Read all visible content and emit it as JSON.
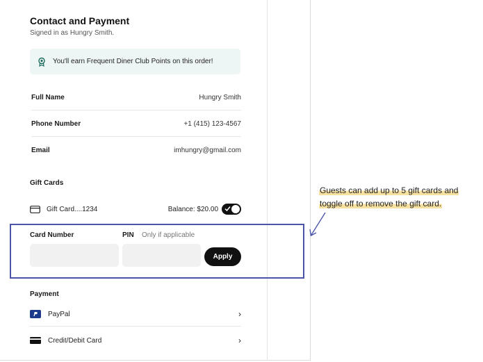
{
  "header": {
    "title": "Contact and Payment",
    "subtitle": "Signed in as Hungry Smith."
  },
  "banner": {
    "icon": "award-badge-icon",
    "text": "You'll earn Frequent Diner Club Points on this order!"
  },
  "contact": [
    {
      "label": "Full Name",
      "value": "Hungry Smith"
    },
    {
      "label": "Phone Number",
      "value": "+1 (415) 123-4567"
    },
    {
      "label": "Email",
      "value": "imhungry@gmail.com"
    }
  ],
  "gift_cards": {
    "section_title": "Gift Cards",
    "card_name": "Gift Card....1234",
    "balance": "Balance: $20.00",
    "toggle_on": true,
    "card_number_label": "Card Number",
    "pin_label": "PIN",
    "pin_hint": "Only if applicable",
    "card_number_value": "",
    "pin_value": "",
    "apply_label": "Apply"
  },
  "payment": {
    "section_title": "Payment",
    "methods": [
      {
        "label": "PayPal",
        "icon": "paypal-icon"
      },
      {
        "label": "Credit/Debit Card",
        "icon": "credit-card-icon"
      }
    ]
  },
  "annotation": {
    "line1": "Guests can add up to 5 gift cards and",
    "line2": "toggle off to remove the gift card."
  },
  "colors": {
    "highlight_border": "#4a55a8",
    "banner_bg": "#eef6f5",
    "annotation_highlight": "#f7e1a1",
    "toggle_bg": "#111111"
  }
}
